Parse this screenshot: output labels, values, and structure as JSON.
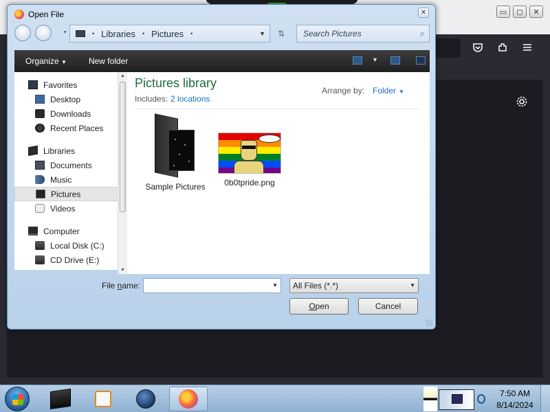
{
  "dialog": {
    "title": "Open File",
    "close_label": "✕",
    "address": {
      "segments": [
        "Libraries",
        "Pictures"
      ],
      "separator": "•"
    },
    "search": {
      "placeholder": "Search Pictures"
    },
    "command_bar": {
      "organize_label": "Organize",
      "new_folder_label": "New folder"
    },
    "nav_pane": {
      "favorites": {
        "label": "Favorites",
        "items": [
          {
            "label": "Desktop",
            "icon": "desktop-icon"
          },
          {
            "label": "Downloads",
            "icon": "downloads-icon"
          },
          {
            "label": "Recent Places",
            "icon": "recent-places-icon"
          }
        ]
      },
      "libraries": {
        "label": "Libraries",
        "items": [
          {
            "label": "Documents",
            "icon": "documents-icon"
          },
          {
            "label": "Music",
            "icon": "music-icon"
          },
          {
            "label": "Pictures",
            "icon": "pictures-icon",
            "selected": true
          },
          {
            "label": "Videos",
            "icon": "videos-icon"
          }
        ]
      },
      "computer": {
        "label": "Computer",
        "items": [
          {
            "label": "Local Disk (C:)",
            "icon": "local-disk-icon"
          },
          {
            "label": "CD Drive (E:)",
            "icon": "cd-drive-icon"
          }
        ]
      }
    },
    "content": {
      "title": "Pictures library",
      "includes_label": "Includes:",
      "includes_link": "2 locations",
      "arrange_label": "Arrange by:",
      "arrange_value": "Folder",
      "items": [
        {
          "label": "Sample Pictures",
          "type": "folder"
        },
        {
          "label": "0b0tpride.png",
          "type": "image"
        }
      ]
    },
    "footer": {
      "file_name_label_prefix": "File ",
      "file_name_label_underlined": "n",
      "file_name_label_suffix": "ame:",
      "file_name_value": "",
      "file_type_value": "All Files (*.*)",
      "open_label_underlined": "O",
      "open_label_rest": "pen",
      "cancel_label": "Cancel"
    }
  },
  "taskbar": {
    "apps": [
      "explorer-icon",
      "media-player-icon",
      "globe-icon",
      "firefox-icon"
    ],
    "clock_time": "7:50 AM",
    "clock_date": "8/14/2024"
  },
  "colors": {
    "dialog_frame": "#cfe0f1",
    "library_title": "#1e6b3b",
    "link": "#1e6fb5",
    "firefox_dark": "#1c1b22"
  }
}
